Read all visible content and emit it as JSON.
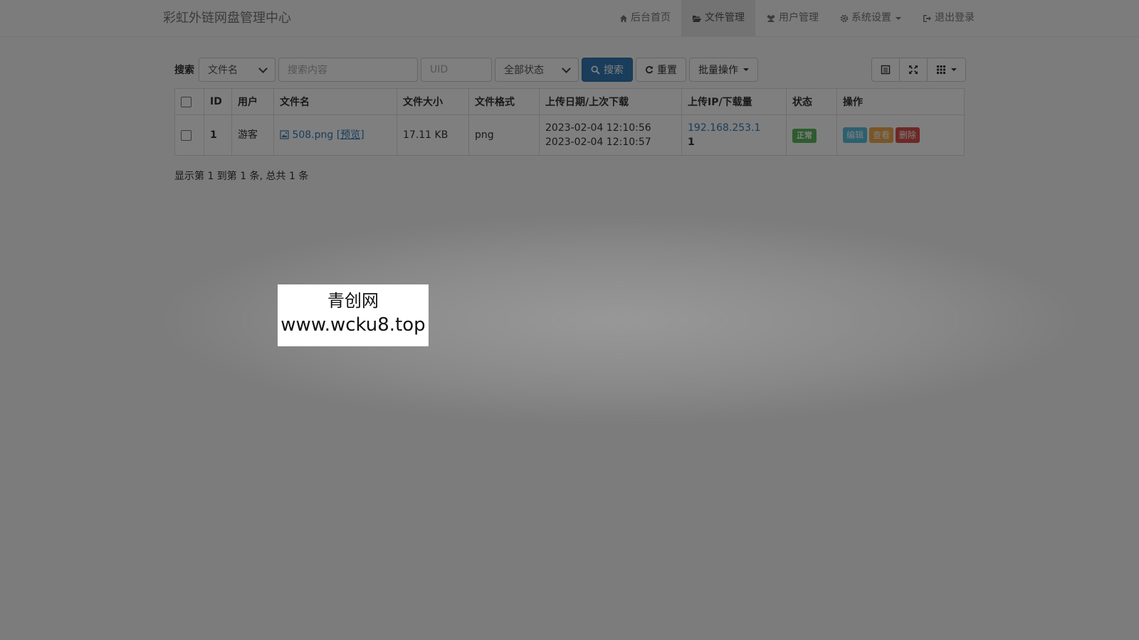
{
  "navbar": {
    "brand": "彩虹外链网盘管理中心",
    "items": [
      {
        "label": "后台首页",
        "icon": "home-icon",
        "active": false
      },
      {
        "label": "文件管理",
        "icon": "folder-open-icon",
        "active": true
      },
      {
        "label": "用户管理",
        "icon": "users-icon",
        "active": false
      },
      {
        "label": "系统设置",
        "icon": "gear-icon",
        "active": false,
        "dropdown": true
      },
      {
        "label": "退出登录",
        "icon": "logout-icon",
        "active": false
      }
    ]
  },
  "toolbar": {
    "search_label": "搜索",
    "field_select": "文件名",
    "search_placeholder": "搜索内容",
    "uid_placeholder": "UID",
    "status_select": "全部状态",
    "search_button": "搜索",
    "reset_button": "重置",
    "batch_button": "批量操作"
  },
  "table": {
    "headers": [
      "ID",
      "用户",
      "文件名",
      "文件大小",
      "文件格式",
      "上传日期/上次下载",
      "上传IP/下载量",
      "状态",
      "操作"
    ],
    "rows": [
      {
        "id": "1",
        "user": "游客",
        "filename": "508.png",
        "preview": "[预览]",
        "size": "17.11 KB",
        "format": "png",
        "upload_date": "2023-02-04 12:10:56",
        "last_download": "2023-02-04 12:10:57",
        "ip": "192.168.253.1",
        "downloads": "1",
        "status": "正常",
        "actions": {
          "edit": "编辑",
          "view": "查看",
          "delete": "删除"
        }
      }
    ]
  },
  "pagination_text": "显示第 1 到第 1 条, 总共 1 条",
  "watermark": {
    "line1": "青创网",
    "line2": "www.wcku8.top"
  },
  "colors": {
    "primary": "#337ab7",
    "success": "#5cb85c",
    "info": "#5bc0de",
    "warning": "#f0ad4e",
    "danger": "#d9534f"
  }
}
